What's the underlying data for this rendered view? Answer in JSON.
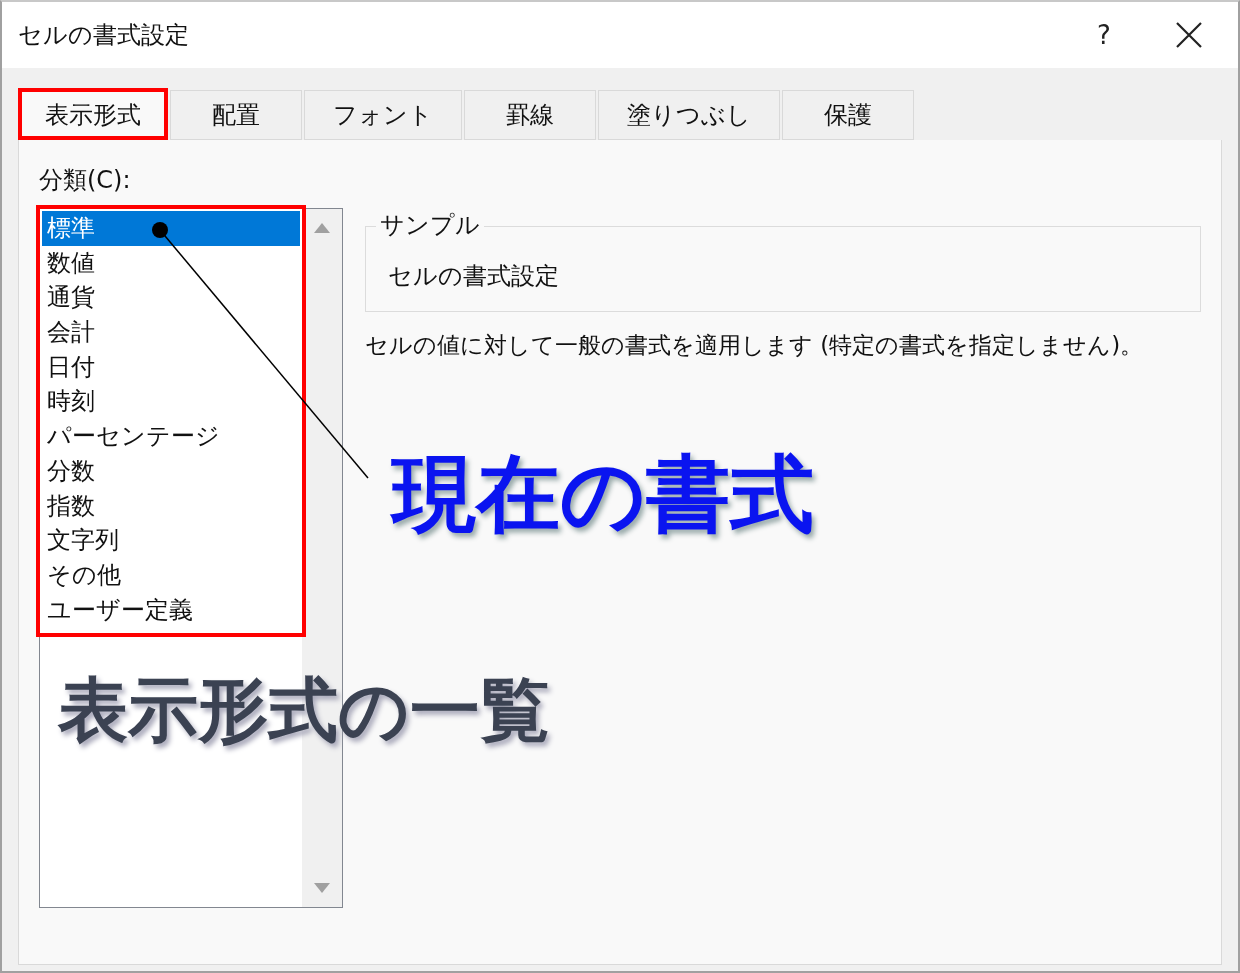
{
  "window": {
    "title": "セルの書式設定",
    "help": "?"
  },
  "tabs": [
    {
      "label": "表示形式",
      "selected": true
    },
    {
      "label": "配置",
      "selected": false
    },
    {
      "label": "フォント",
      "selected": false
    },
    {
      "label": "罫線",
      "selected": false
    },
    {
      "label": "塗りつぶし",
      "selected": false
    },
    {
      "label": "保護",
      "selected": false
    }
  ],
  "category": {
    "label": "分類(C):",
    "items": [
      {
        "label": "標準",
        "selected": true
      },
      {
        "label": "数値",
        "selected": false
      },
      {
        "label": "通貨",
        "selected": false
      },
      {
        "label": "会計",
        "selected": false
      },
      {
        "label": "日付",
        "selected": false
      },
      {
        "label": "時刻",
        "selected": false
      },
      {
        "label": "パーセンテージ",
        "selected": false
      },
      {
        "label": "分数",
        "selected": false
      },
      {
        "label": "指数",
        "selected": false
      },
      {
        "label": "文字列",
        "selected": false
      },
      {
        "label": "その他",
        "selected": false
      },
      {
        "label": "ユーザー定義",
        "selected": false
      }
    ]
  },
  "sample": {
    "legend": "サンプル",
    "value": "セルの書式設定"
  },
  "description": "セルの値に対して一般の書式を適用します (特定の書式を指定しません)。",
  "annotations": {
    "current_format": "現在の書式",
    "format_list": "表示形式の一覧"
  }
}
